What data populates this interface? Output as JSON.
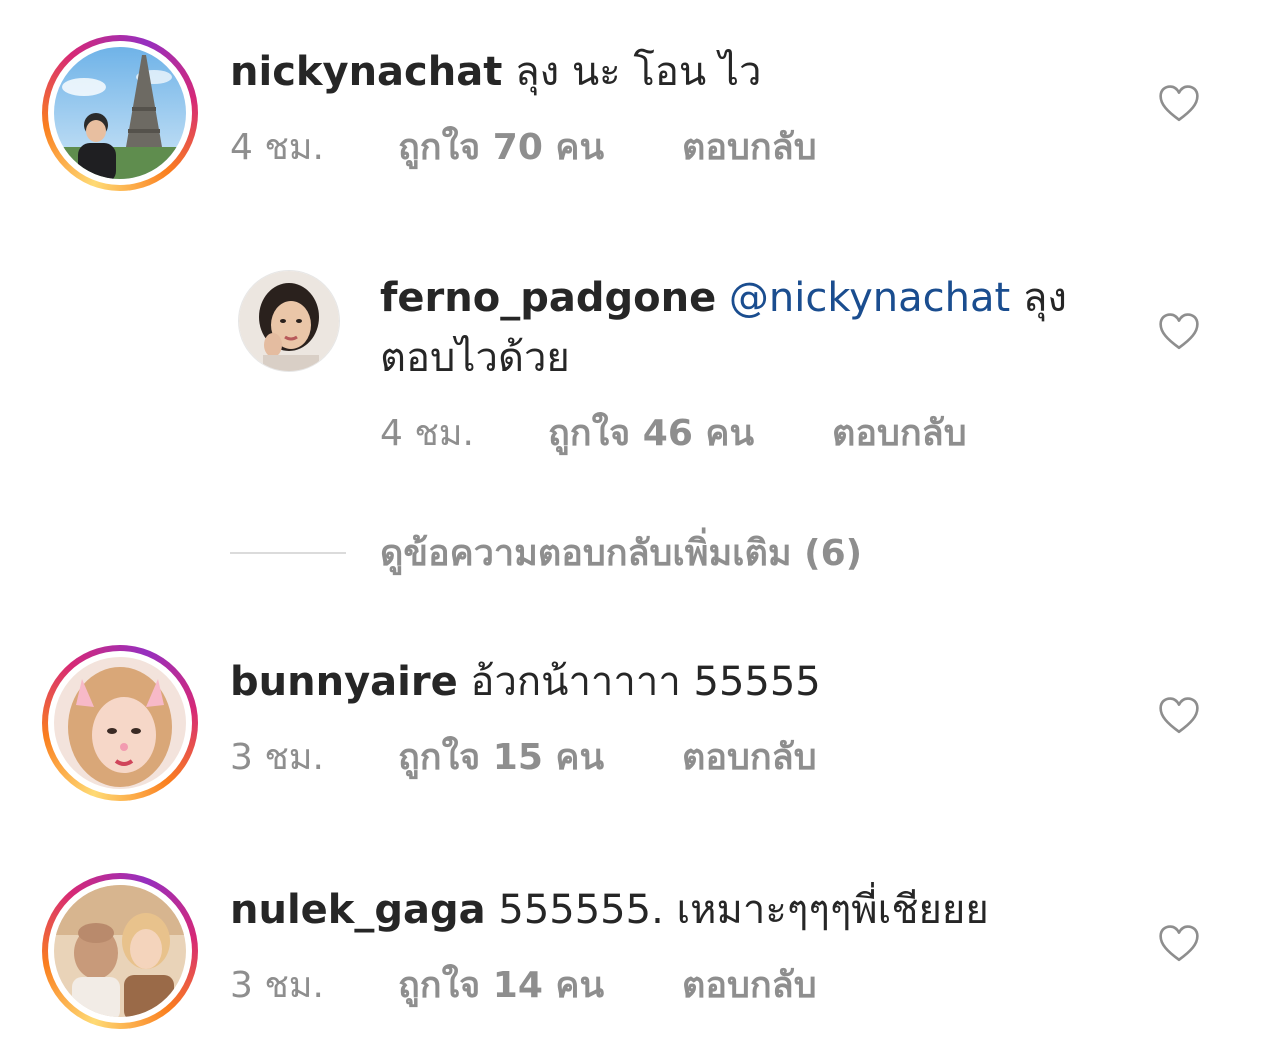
{
  "comments": [
    {
      "username": "nickynachat",
      "text": "ลุง นะ โอน ไว",
      "time": "4 ชม.",
      "likes": "ถูกใจ 70 คน",
      "reply": "ตอบกลับ"
    },
    {
      "username": "bunnyaire",
      "text": "อ้วกน้าาาาา 55555",
      "time": "3 ชม.",
      "likes": "ถูกใจ 15 คน",
      "reply": "ตอบกลับ"
    },
    {
      "username": "nulek_gaga",
      "text": "555555. เหมาะๆๆๆพี่เชียยย",
      "time": "3 ชม.",
      "likes": "ถูกใจ 14 คน",
      "reply": "ตอบกลับ"
    }
  ],
  "reply_comment": {
    "username": "ferno_padgone",
    "mention": "@nickynachat",
    "text_line1": "ลุง",
    "text_line2": "ตอบไวด้วย",
    "time": "4 ชม.",
    "likes": "ถูกใจ 46 คน",
    "reply": "ตอบกลับ"
  },
  "more_replies": {
    "label": "ดูข้อความตอบกลับเพิ่มเติม (6)"
  },
  "icons": {
    "heart": "heart-outline-icon"
  },
  "colors": {
    "text": "#262626",
    "meta": "#8e8e8e",
    "mention": "#1a4d8f",
    "divider": "#dbdbdb"
  }
}
